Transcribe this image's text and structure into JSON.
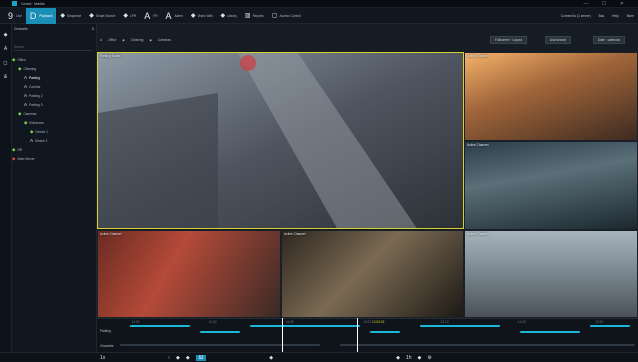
{
  "window": {
    "title": "Control · Monitor",
    "controls": "— ☐ ✕"
  },
  "toolbar": {
    "items": [
      {
        "icon": "9",
        "label": "Live"
      },
      {
        "icon": "D",
        "label": "Playback",
        "active": true
      },
      {
        "icon": "◆",
        "label": "Sequence"
      },
      {
        "icon": "◆",
        "label": "Smart Search"
      },
      {
        "icon": "◆",
        "label": "LPR"
      },
      {
        "icon": "A",
        "label": "FR"
      },
      {
        "icon": "A",
        "label": "Alarm"
      },
      {
        "icon": "◆",
        "label": "Video Wall"
      },
      {
        "icon": "◆",
        "label": "Library"
      },
      {
        "icon": "▥",
        "label": "Reports"
      },
      {
        "icon": "▢",
        "label": "Access Control"
      }
    ],
    "right": {
      "connect": "Connect to (1 server)",
      "user": "Bas",
      "help": "Help",
      "more": "More"
    }
  },
  "sidebar": {
    "header": "Channels",
    "search_placeholder": "Search",
    "tree": [
      {
        "label": "Office",
        "indent": 0,
        "icon": "◆",
        "sel": false
      },
      {
        "label": "Cleaning",
        "indent": 1,
        "icon": "◆",
        "sel": false
      },
      {
        "label": "Parking",
        "indent": 2,
        "icon": "A",
        "sel": true
      },
      {
        "label": "Corridor",
        "indent": 2,
        "icon": "A",
        "sel": false
      },
      {
        "label": "Parking 2",
        "indent": 2,
        "icon": "A",
        "sel": false
      },
      {
        "label": "Parking 3",
        "indent": 2,
        "icon": "A",
        "sel": false
      },
      {
        "label": "Cameras",
        "indent": 1,
        "icon": "◆",
        "sel": false
      },
      {
        "label": "Entrances",
        "indent": 2,
        "icon": "◆",
        "sel": false
      },
      {
        "label": "Device 1",
        "indent": 3,
        "icon": "◆",
        "sel": false
      },
      {
        "label": "Device 2",
        "indent": 3,
        "icon": "A",
        "sel": false
      },
      {
        "label": "NR",
        "indent": 0,
        "icon": "◆",
        "sel": false
      },
      {
        "label": "Main Server",
        "indent": 0,
        "icon": "◆",
        "sel": false,
        "alarm": true
      }
    ]
  },
  "breadcrumb": [
    "Office",
    "Cleaning",
    "Cameras"
  ],
  "view_buttons": {
    "fullscreen": "Fullscreen · Layout",
    "search": "Add search",
    "calendar": "Date · calendar"
  },
  "tiles": [
    {
      "label": "Parking South",
      "selected": true
    },
    {
      "label": "Active Channel"
    },
    {
      "label": "Active Channel"
    },
    {
      "label": "Active Channel"
    },
    {
      "label": "Active Channel"
    },
    {
      "label": "Active Channel"
    }
  ],
  "timeline": {
    "ticks": [
      "11:30",
      "11:40",
      "11:50",
      "12:00",
      "12:10",
      "12:20",
      "12:30"
    ],
    "tracks": [
      {
        "label": "Parking"
      },
      {
        "label": "Channels"
      }
    ],
    "cursor_time": "12:05:32"
  },
  "bottom": {
    "speed": "1x",
    "zoom_label": "1h"
  },
  "colors": {
    "accent": "#1a8fb6",
    "selected_border": "#d6d12e",
    "online": "#7fd24a",
    "alarm": "#e04b3c"
  }
}
